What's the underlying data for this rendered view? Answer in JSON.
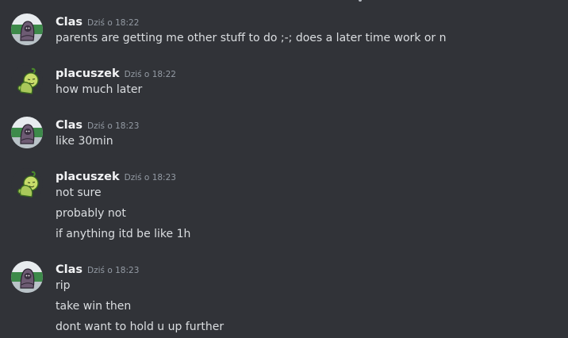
{
  "messages": [
    {
      "author": "Clas",
      "timestamp": "Dziś o 18:22",
      "lines": [
        "parents are getting me other stuff to do ;-; does a later time work or n"
      ]
    },
    {
      "author": "placuszek",
      "timestamp": "Dziś o 18:22",
      "lines": [
        "how much later"
      ]
    },
    {
      "author": "Clas",
      "timestamp": "Dziś o 18:23",
      "lines": [
        "like 30min"
      ]
    },
    {
      "author": "placuszek",
      "timestamp": "Dziś o 18:23",
      "lines": [
        "not sure",
        "probably not",
        "if anything itd be like 1h"
      ]
    },
    {
      "author": "Clas",
      "timestamp": "Dziś o 18:23",
      "lines": [
        "rip",
        "take win then",
        "dont want to hold u up further"
      ]
    }
  ],
  "colors": {
    "background": "#313338",
    "username": "#f2f3f5",
    "timestamp": "#949ba4",
    "message_text": "#dbdee1"
  },
  "icons": {
    "clas_avatar": "hooded-figure-avatar",
    "placuszek_avatar": "green-frog-avatar"
  }
}
